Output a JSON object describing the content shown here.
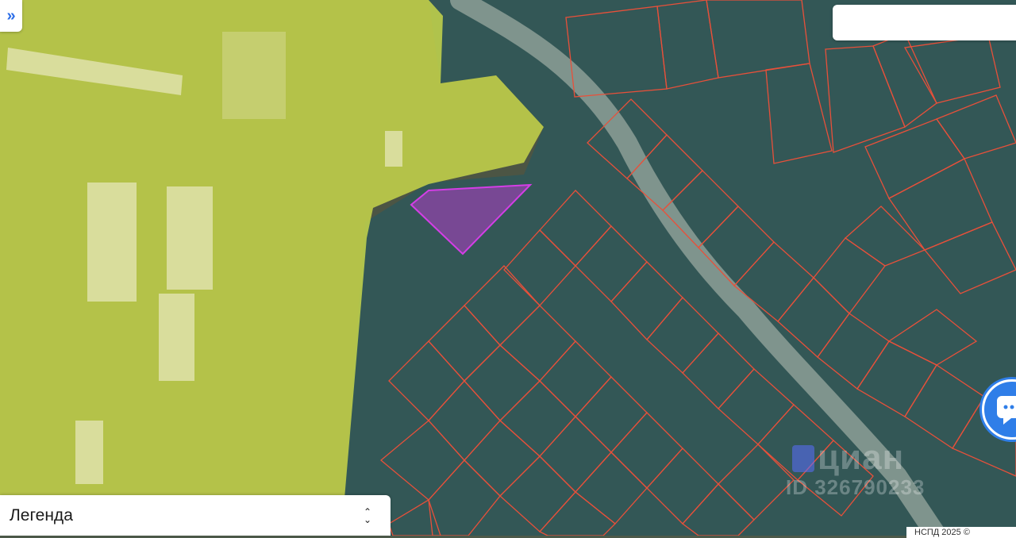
{
  "map": {
    "colors": {
      "zone_yellow": "#c7d64a",
      "zone_teal": "#1f5a66",
      "parcel_stroke": "#e8503a",
      "selected_fill": "#b03cc8",
      "selected_stroke": "#d43ee6",
      "road": "#8a9a90",
      "field": "#4c5544"
    },
    "selected_parcel": "selected-parcel"
  },
  "controls": {
    "expand_icon": "double-chevron-right-icon",
    "expand_glyph": "»",
    "search_placeholder": "",
    "chat_icon": "chat-bubble-icon"
  },
  "legend": {
    "title": "Легенда",
    "toggle_up": "⌃",
    "toggle_down": "⌄"
  },
  "watermark": {
    "brand": "циан",
    "id": "ID 326790233"
  },
  "copyright": "НСПД 2025 ©"
}
